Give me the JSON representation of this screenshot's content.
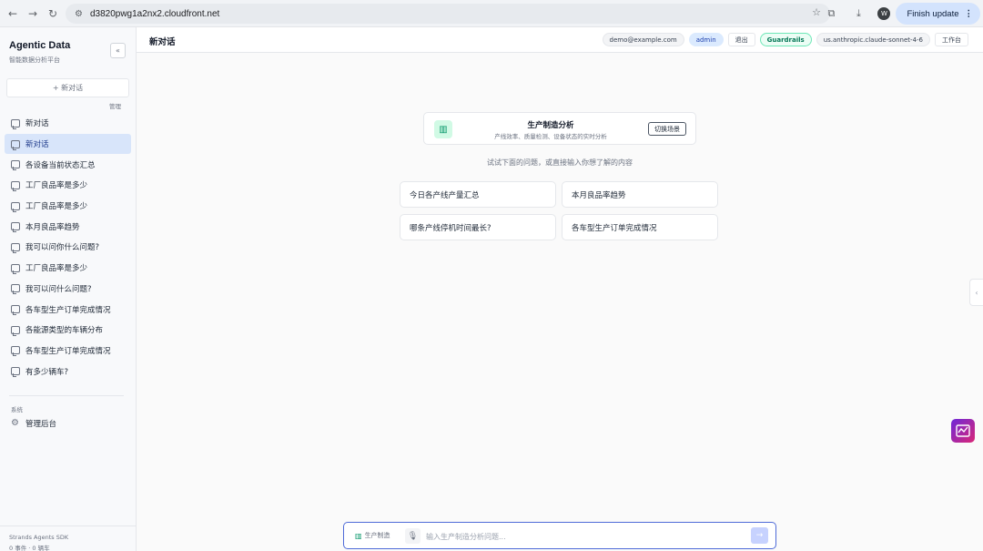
{
  "browser": {
    "url": "d3820pwg1a2nx2.cloudfront.net",
    "profile_initial": "W",
    "finish_update_label": "Finish update"
  },
  "sidebar": {
    "title": "Agentic Data",
    "subtitle": "智能数据分析平台",
    "new_chat_label": "+ 新对话",
    "manage_label": "管理",
    "conversations": [
      {
        "label": "新对话"
      },
      {
        "label": "新对话"
      },
      {
        "label": "各设备当前状态汇总"
      },
      {
        "label": "工厂良品率是多少"
      },
      {
        "label": "工厂良品率是多少"
      },
      {
        "label": "本月良品率趋势"
      },
      {
        "label": "我可以问你什么问题?"
      },
      {
        "label": "工厂良品率是多少"
      },
      {
        "label": "我可以问什么问题?"
      },
      {
        "label": "各车型生产订单完成情况"
      },
      {
        "label": "各能源类型的车辆分布"
      },
      {
        "label": "各车型生产订单完成情况"
      },
      {
        "label": "有多少辆车?"
      }
    ],
    "active_index": 1,
    "system_label": "系统",
    "admin_label": "管理后台",
    "footer_sdk": "Strands Agents SDK",
    "footer_counts": "0 事件 · 0 辆车"
  },
  "header": {
    "title": "新对话",
    "email": "demo@example.com",
    "role": "admin",
    "logout": "退出",
    "guardrails": "Guardrails",
    "model": "us.anthropic.claude-sonnet-4-6",
    "workspace": "工作台"
  },
  "main": {
    "scenario_title": "生产制造分析",
    "scenario_desc": "产线效率、质量检测、设备状态的实时分析",
    "switch_label": "切换场景",
    "hint": "试试下面的问题，或直接输入你想了解的内容",
    "suggestions": [
      {
        "label": "今日各产线产量汇总"
      },
      {
        "label": "本月良品率趋势"
      },
      {
        "label": "哪条产线停机时间最长?"
      },
      {
        "label": "各车型生产订单完成情况"
      }
    ]
  },
  "input": {
    "scene_chip": "生产制造",
    "placeholder": "输入生产制造分析问题..."
  },
  "colors": {
    "accent": "#4f6bd8",
    "active_item_bg": "#d8e5fa",
    "guardrails": "#047857"
  }
}
